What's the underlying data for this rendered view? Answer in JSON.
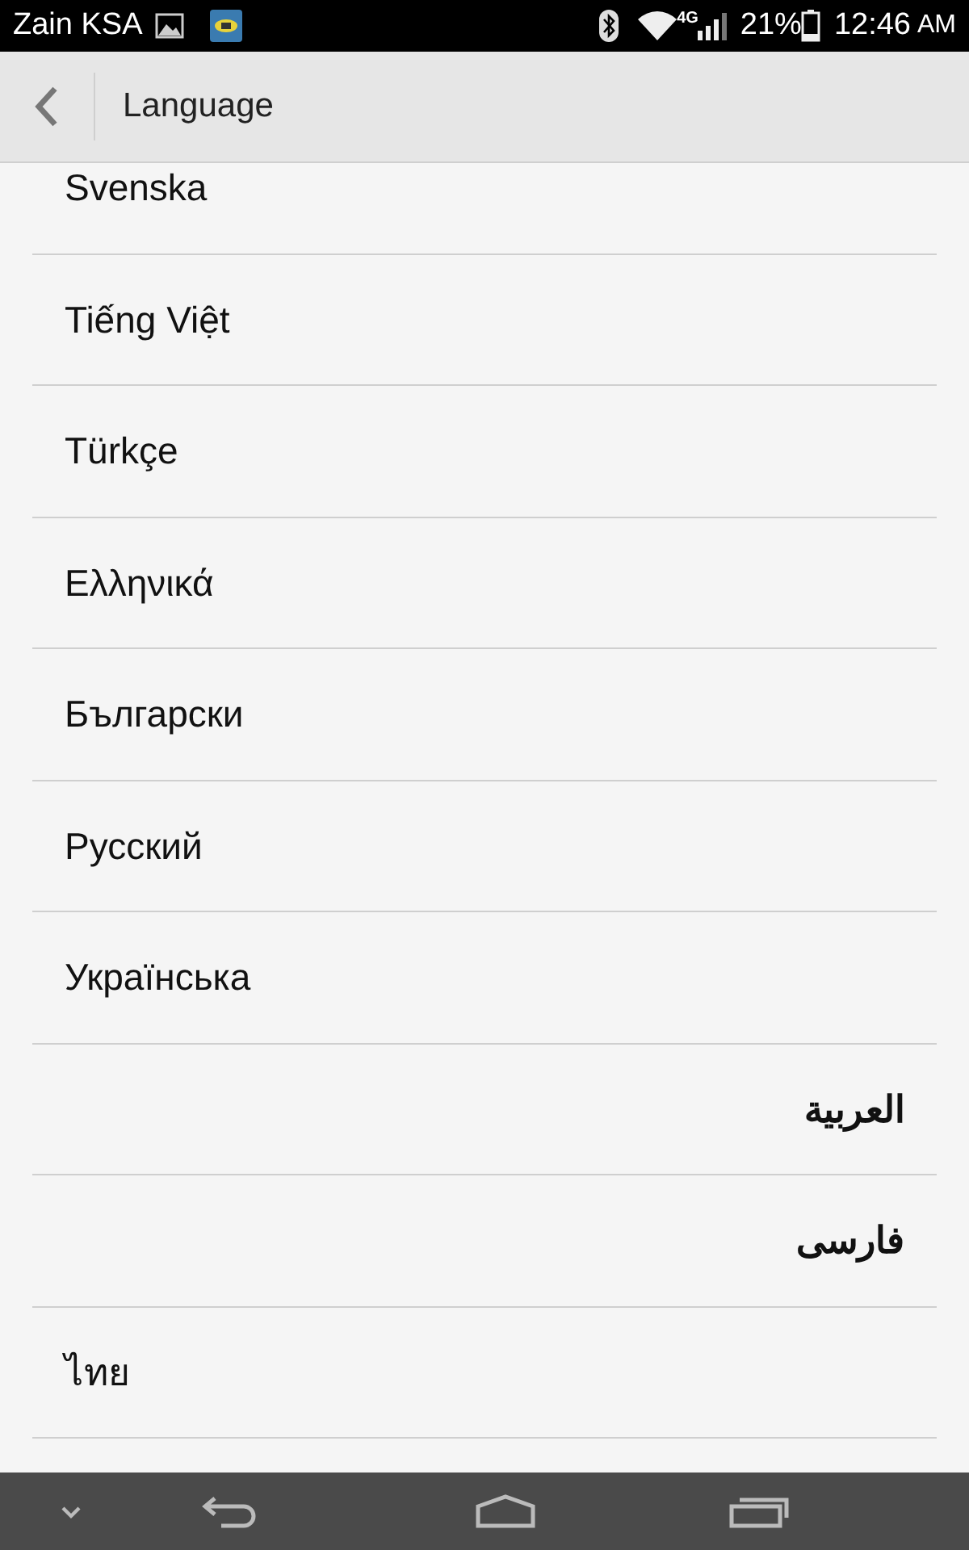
{
  "status_bar": {
    "carrier": "Zain KSA",
    "network": "4G",
    "battery": "21%",
    "time": "12:46",
    "ampm": "AM"
  },
  "header": {
    "title": "Language"
  },
  "languages": [
    {
      "label": "Svenska",
      "kind": "ltr"
    },
    {
      "label": "Tiếng Việt",
      "kind": "ltr"
    },
    {
      "label": "Türkçe",
      "kind": "ltr"
    },
    {
      "label": "Ελληνικά",
      "kind": "ltr"
    },
    {
      "label": "Български",
      "kind": "ltr"
    },
    {
      "label": "Русский",
      "kind": "ltr"
    },
    {
      "label": "Українська",
      "kind": "ltr"
    },
    {
      "label": "العربية",
      "kind": "rtl"
    },
    {
      "label": "فارسی",
      "kind": "rtl"
    },
    {
      "label": "ไทย",
      "kind": "ltr"
    }
  ]
}
